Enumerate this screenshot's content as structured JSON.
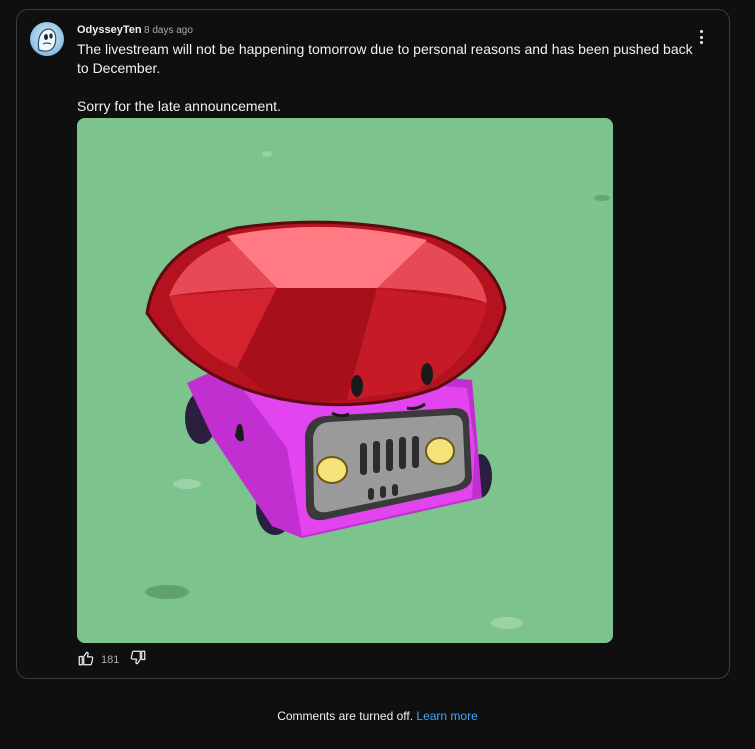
{
  "post": {
    "author": "OdysseyTen",
    "timestamp": "8 days ago",
    "text": "The livestream will not be happening tomorrow due to personal reasons and has been pushed back to December.\n\nSorry for the late announcement.",
    "like_count": "181",
    "menu_icon": "more-vert-icon"
  },
  "footer": {
    "comments_off": "Comments are turned off.",
    "learn_more": "Learn more"
  },
  "colors": {
    "background": "#0f0f0f",
    "link": "#3ea6ff",
    "image_bg": "#7dc38d",
    "gem": "#e0303a",
    "car": "#d43ae6"
  }
}
